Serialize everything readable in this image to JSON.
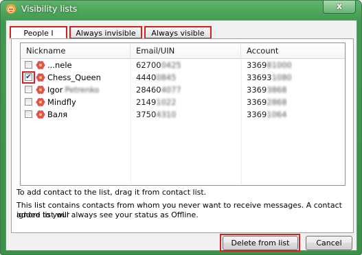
{
  "window": {
    "title": "Visibility lists",
    "close_glyph": "x"
  },
  "tabs": [
    {
      "label": "People I ignore"
    },
    {
      "label": "Always invisible to..."
    },
    {
      "label": "Always visible to.."
    }
  ],
  "table": {
    "columns": [
      "Nickname",
      "Email/UIN",
      "Account"
    ],
    "rows": [
      {
        "checked": false,
        "nickname": "...nele",
        "nickname_hidden": "",
        "email_visible": "62700",
        "email_hidden": "0425",
        "account_visible": "3369",
        "account_hidden": "81000"
      },
      {
        "checked": true,
        "nickname": "Chess_Queen",
        "nickname_hidden": "",
        "email_visible": "4440",
        "email_hidden": "0845",
        "account_visible": "33693",
        "account_hidden": "1080"
      },
      {
        "checked": false,
        "nickname": "Igor",
        "nickname_hidden": "Petrenko",
        "email_visible": "28460",
        "email_hidden": "4077",
        "account_visible": "3369",
        "account_hidden": "3868"
      },
      {
        "checked": false,
        "nickname": "Mindfly",
        "nickname_hidden": "",
        "email_visible": "2149",
        "email_hidden": "1022",
        "account_visible": "3369",
        "account_hidden": "2868"
      },
      {
        "checked": false,
        "nickname": "Валя",
        "nickname_hidden": "",
        "email_visible": "3750",
        "email_hidden": "4310",
        "account_visible": "3369",
        "account_hidden": "1064"
      }
    ]
  },
  "hints": {
    "drag": "To add contact to the list, drag it from contact list.",
    "line1": "This list contains contacts from whom you never want to receive messages. A contact added to your",
    "line2": "ignore list will always see your status as Offline."
  },
  "buttons": {
    "delete": "Delete from list",
    "cancel": "Cancel"
  },
  "colors": {
    "highlight": "#d41f1f",
    "frame": "#3f9a4f",
    "flower": "#e8525a"
  },
  "icons": {
    "app": "qip-flower-face-icon",
    "contact": "flower-status-icon",
    "check": "checkmark"
  }
}
